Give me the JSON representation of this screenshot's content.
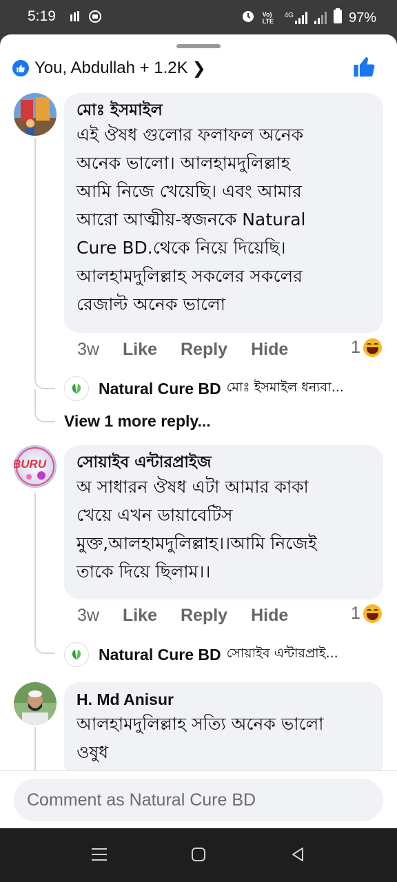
{
  "status_bar": {
    "time": "5:19",
    "battery": "97%",
    "net_label_top": "Vo) LTE",
    "net_label_4g": "4G"
  },
  "reactions": {
    "summary": "You, Abdullah + 1.2K",
    "chevron": "❯"
  },
  "comments": [
    {
      "author": "মোঃ ইসমাইল",
      "lines": [
        "এই ঔষধ গুলোর ফলাফল অনেক",
        "অনেক ভালো। আলহামদুলিল্লাহ",
        "আমি নিজে খেয়েছি। এবং আমার",
        "আরো  আত্মীয়-স্বজনকে  Natural",
        "Cure BD.থেকে  নিয়ে দিয়েছি।",
        "আলহামদুলিল্লাহ সকলের সকলের",
        "রেজাল্ট অনেক  ভালো"
      ],
      "time": "3w",
      "like": "Like",
      "reply": "Reply",
      "hide": "Hide",
      "reaction_count": "1",
      "reply_preview": {
        "name": "Natural Cure BD",
        "snippet": "মোঃ ইসমাইল  ধন্যবা..."
      },
      "view_more": "View 1 more reply..."
    },
    {
      "author": "সোয়াইব এন্টারপ্রাইজ",
      "lines": [
        "অ সাধারন ঔষধ  এটা আমার কাকা",
        "খেয়ে এখন ডায়াবেটিস",
        "মুক্ত,আলহামদুলিল্লাহ।।আমি নিজেই",
        "তাকে দিয়ে ছিলাম।।"
      ],
      "time": "3w",
      "like": "Like",
      "reply": "Reply",
      "hide": "Hide",
      "reaction_count": "1",
      "reply_preview": {
        "name": "Natural Cure BD",
        "snippet": "সোয়াইব এন্টারপ্রাই..."
      }
    },
    {
      "author": "H. Md Anisur",
      "lines": [
        "আলহামদুলিল্লাহ  সত্যি অনেক ভালো",
        "ওষুধ"
      ]
    }
  ],
  "avatar_badge_text": "BURU",
  "composer": {
    "placeholder": "Comment as Natural Cure BD"
  },
  "colors": {
    "facebook_blue": "#1877f2",
    "bubble_bg": "#f0f2f5",
    "haha_yellow": "#f7b928"
  }
}
